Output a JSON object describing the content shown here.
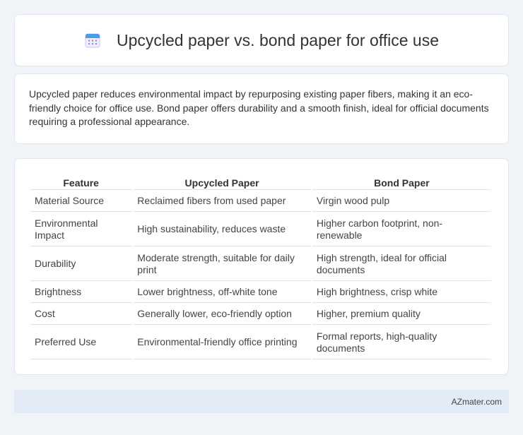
{
  "header": {
    "title": "Upcycled paper vs. bond paper for office use",
    "icon": "calendar-icon"
  },
  "intro": {
    "text": "Upcycled paper reduces environmental impact by repurposing existing paper fibers, making it an eco-friendly choice for office use. Bond paper offers durability and a smooth finish, ideal for official documents requiring a professional appearance."
  },
  "table": {
    "headers": [
      "Feature",
      "Upcycled Paper",
      "Bond Paper"
    ],
    "rows": [
      [
        "Material Source",
        "Reclaimed fibers from used paper",
        "Virgin wood pulp"
      ],
      [
        "Environmental Impact",
        "High sustainability, reduces waste",
        "Higher carbon footprint, non-renewable"
      ],
      [
        "Durability",
        "Moderate strength, suitable for daily print",
        "High strength, ideal for official documents"
      ],
      [
        "Brightness",
        "Lower brightness, off-white tone",
        "High brightness, crisp white"
      ],
      [
        "Cost",
        "Generally lower, eco-friendly option",
        "Higher, premium quality"
      ],
      [
        "Preferred Use",
        "Environmental-friendly office printing",
        "Formal reports, high-quality documents"
      ]
    ]
  },
  "footer": {
    "text": "AZmater.com"
  }
}
